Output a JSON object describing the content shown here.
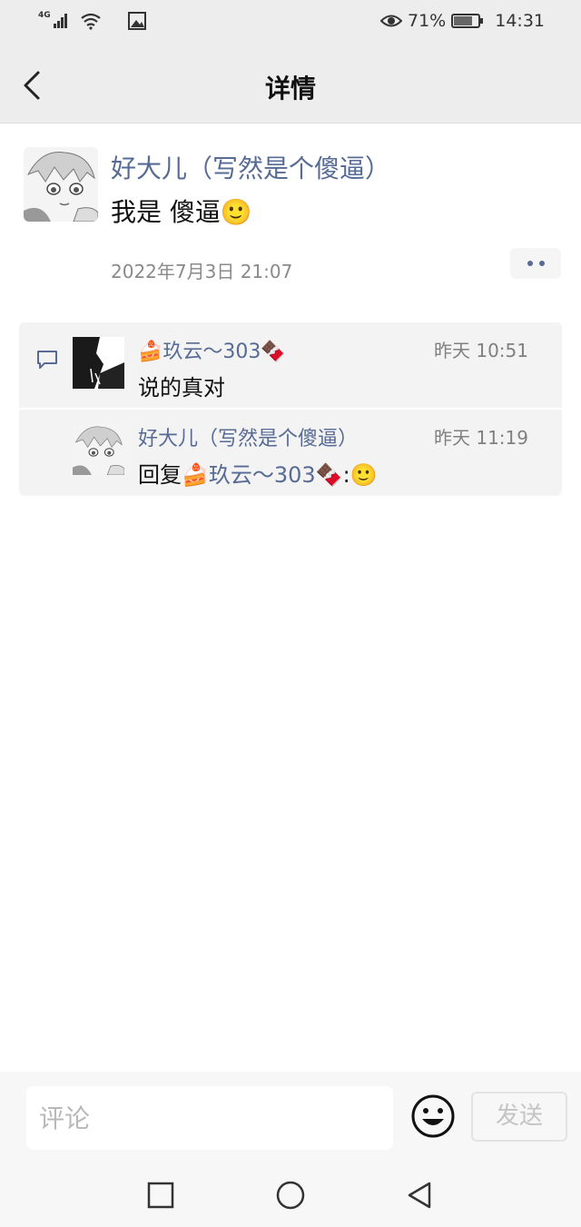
{
  "status_bar": {
    "network": "4G",
    "battery": "71%",
    "time": "14:31"
  },
  "header": {
    "title": "详情"
  },
  "post": {
    "author": "好大儿（写然是个傻逼）",
    "text": "我是 傻逼🙂",
    "time": "2022年7月3日 21:07"
  },
  "comments": [
    {
      "author": "🍰玖云～303🍫",
      "time": "昨天 10:51",
      "text": "说的真对"
    },
    {
      "author": "好大儿（写然是个傻逼）",
      "time": "昨天 11:19",
      "reply_prefix": "回复",
      "reply_to": "🍰玖云～303🍫",
      "reply_suffix": ":🙂"
    }
  ],
  "input": {
    "placeholder": "评论",
    "send_label": "发送"
  },
  "icons": {
    "back": "chevron-left-icon",
    "more": "more-dots-icon",
    "comment": "comment-bubble-icon",
    "emoji": "smiley-face-icon",
    "nav_recent": "square-icon",
    "nav_home": "circle-icon",
    "nav_back": "triangle-back-icon"
  },
  "colors": {
    "name_blue": "#576b95",
    "panel_gray": "#f3f3f3",
    "header_gray": "#ededed"
  }
}
